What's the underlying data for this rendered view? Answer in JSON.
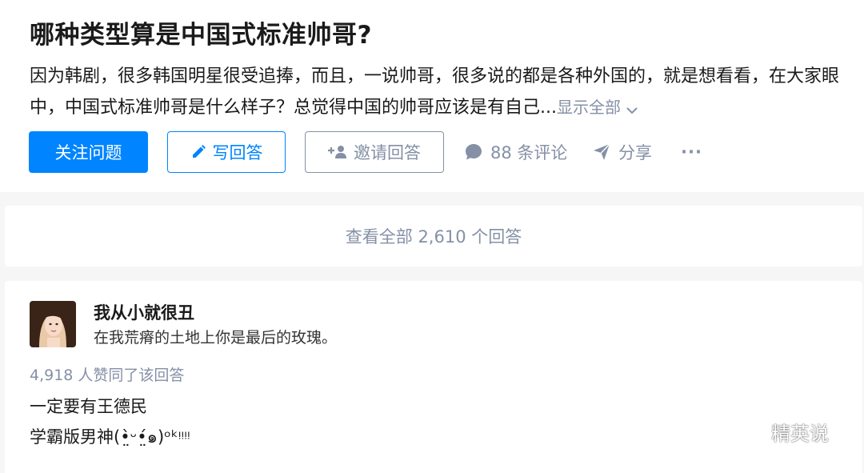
{
  "question": {
    "title": "哪种类型算是中国式标准帅哥?",
    "description": "因为韩剧，很多韩国明星很受追捧，而且，一说帅哥，很多说的都是各种外国的，就是想看看，在大家眼中，中国式标准帅哥是什么样子？总觉得中国的帅哥应该是有自己...",
    "show_all_label": "显示全部"
  },
  "actions": {
    "follow_label": "关注问题",
    "write_label": "写回答",
    "invite_label": "邀请回答",
    "comments_label": "88 条评论",
    "share_label": "分享",
    "more_label": "···"
  },
  "view_all_label": "查看全部 2,610 个回答",
  "answer": {
    "author_name": "我从小就很丑",
    "author_bio": "在我荒瘠的土地上你是最后的玫瑰。",
    "votes_label": "4,918 人赞同了该回答",
    "lines": [
      "一定要有王德民",
      "学霸版男神(•̤̀ᵕ•̤́๑)ᵒᵏᵎᵎᵎᵎ"
    ]
  },
  "watermark": "精英说",
  "colors": {
    "accent": "#0084ff",
    "muted": "#8590a6",
    "background": "#f6f6f6"
  },
  "icons": [
    "pencil-icon",
    "add-user-icon",
    "comment-icon",
    "paper-plane-icon",
    "more-dots-icon",
    "chevron-down-icon",
    "wechat-icon"
  ]
}
